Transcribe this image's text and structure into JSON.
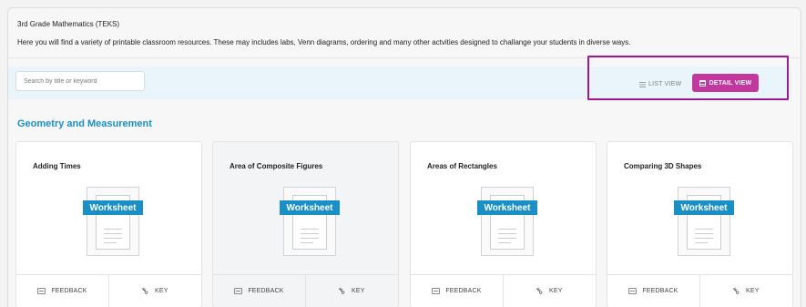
{
  "header": {
    "subject": "3rd Grade Mathematics (TEKS)",
    "description": "Here you will find a variety of printable classroom resources. These may includes labs, Venn diagrams, ordering and many other actvities designed to challange your students in diverse ways."
  },
  "search": {
    "placeholder": "Search by title or keyword",
    "value": ""
  },
  "view_toggle": {
    "list_label": "LIST VIEW",
    "detail_label": "DETAIL VIEW",
    "selected": "DETAIL VIEW",
    "accent": "#c2389f",
    "highlight": "#9c1c8f"
  },
  "section": {
    "title": "Geometry and Measurement",
    "color": "#1a8fc6"
  },
  "cards": [
    {
      "title": "Adding Times",
      "type_label": "Worksheet",
      "feedback_label": "FEEDBACK",
      "key_label": "KEY"
    },
    {
      "title": "Area of Composite Figures",
      "type_label": "Worksheet",
      "feedback_label": "FEEDBACK",
      "key_label": "KEY"
    },
    {
      "title": "Areas of Rectangles",
      "type_label": "Worksheet",
      "feedback_label": "FEEDBACK",
      "key_label": "KEY"
    },
    {
      "title": "Comparing 3D Shapes",
      "type_label": "Worksheet",
      "feedback_label": "FEEDBACK",
      "key_label": "KEY"
    }
  ],
  "icons": {
    "list": "list-icon",
    "detail": "grid-icon",
    "feedback": "feedback-icon",
    "key": "key-icon"
  }
}
